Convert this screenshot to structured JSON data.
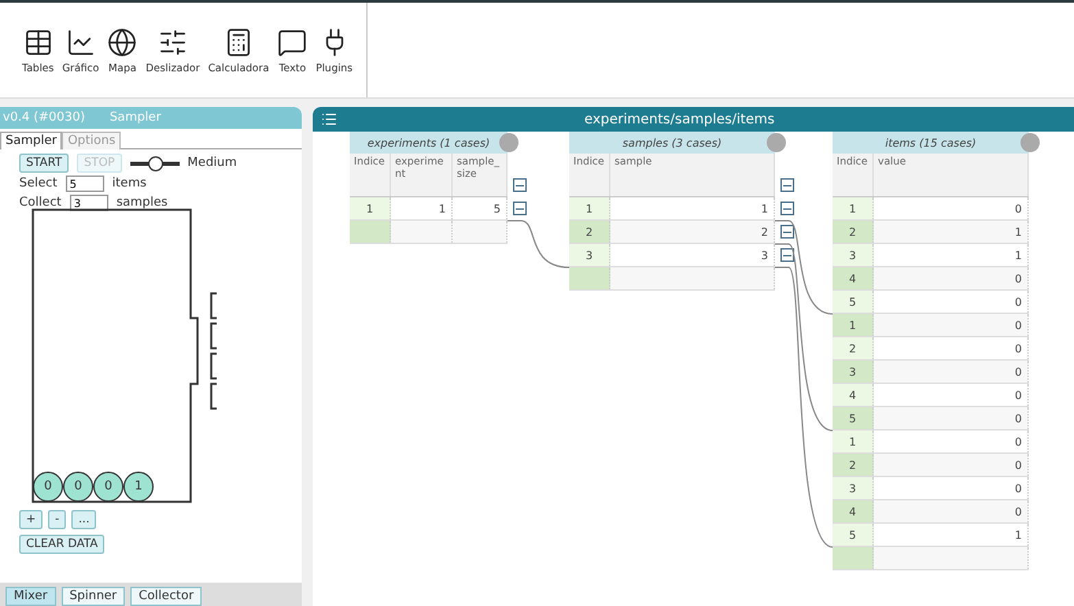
{
  "toolbar": {
    "tools": [
      {
        "label": "Tables",
        "kind": "table"
      },
      {
        "label": "Gráfico",
        "kind": "graph"
      },
      {
        "label": "Mapa",
        "kind": "map"
      },
      {
        "label": "Deslizador",
        "kind": "slider"
      },
      {
        "label": "Calculadora",
        "kind": "calculator"
      },
      {
        "label": "Texto",
        "kind": "text"
      },
      {
        "label": "Plugins",
        "kind": "plugin"
      }
    ]
  },
  "sampler": {
    "version": "v0.4 (#0030)",
    "title": "Sampler",
    "tabs": [
      {
        "label": "Sampler",
        "selected": true
      },
      {
        "label": "Options",
        "selected": false
      }
    ],
    "start": {
      "label": "START",
      "disabled": false
    },
    "stop": {
      "label": "STOP",
      "disabled": true
    },
    "speed": {
      "level": 0.5,
      "label": "Medium"
    },
    "select": {
      "prefix": "Select",
      "value": "5",
      "suffix": "items"
    },
    "collect": {
      "prefix": "Collect",
      "value": "3",
      "suffix": "samples"
    },
    "balls": [
      "0",
      "0",
      "0",
      "1"
    ],
    "small_buttons": [
      "+",
      "-",
      "..."
    ],
    "clear_button": "CLEAR DATA",
    "device_tabs": [
      {
        "label": "Mixer",
        "selected": true
      },
      {
        "label": "Spinner",
        "selected": false
      },
      {
        "label": "Collector",
        "selected": false
      }
    ]
  },
  "case_table": {
    "title": "experiments/samples/items",
    "collections": [
      {
        "title": "experiments (1 cases)",
        "columns": [
          "Indice",
          "experiment",
          "sample_size"
        ],
        "rows": [
          [
            "1",
            "1",
            "5"
          ]
        ]
      },
      {
        "title": "samples (3 cases)",
        "columns": [
          "Indice",
          "sample"
        ],
        "rows": [
          [
            "1",
            "1"
          ],
          [
            "2",
            "2"
          ],
          [
            "3",
            "3"
          ]
        ]
      },
      {
        "title": "items (15 cases)",
        "columns": [
          "Indice",
          "value"
        ],
        "rows": [
          [
            "1",
            "0"
          ],
          [
            "2",
            "1"
          ],
          [
            "3",
            "1"
          ],
          [
            "4",
            "0"
          ],
          [
            "5",
            "0"
          ],
          [
            "1",
            "0"
          ],
          [
            "2",
            "0"
          ],
          [
            "3",
            "0"
          ],
          [
            "4",
            "0"
          ],
          [
            "5",
            "0"
          ],
          [
            "1",
            "0"
          ],
          [
            "2",
            "0"
          ],
          [
            "3",
            "0"
          ],
          [
            "4",
            "0"
          ],
          [
            "5",
            "1"
          ]
        ]
      }
    ]
  }
}
